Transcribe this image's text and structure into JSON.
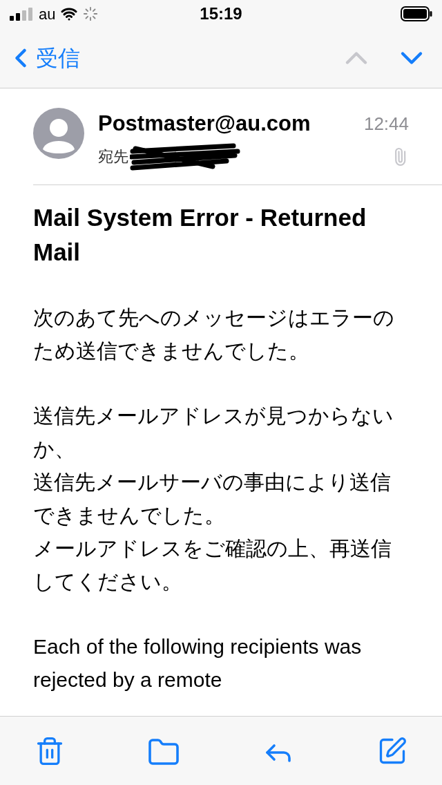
{
  "status_bar": {
    "carrier": "au",
    "time": "15:19"
  },
  "nav": {
    "back_label": "受信",
    "previous": {
      "disabled": true
    },
    "next": {
      "disabled": false
    }
  },
  "message": {
    "sender": "Postmaster@au.com",
    "time": "12:44",
    "to_label": "宛先",
    "has_attachment": true,
    "subject": "Mail System Error - Returned Mail",
    "body": [
      [
        "次のあて先へのメッセージはエラーの",
        "ため送信できませんでした。"
      ],
      [
        "送信先メールアドレスが見つからない",
        "か、",
        "送信先メールサーバの事由により送信",
        "できませんでした。",
        "メールアドレスをご確認の上、再送信",
        "してください。"
      ],
      [
        "Each of the following recipients was",
        "rejected by a remote"
      ]
    ]
  }
}
